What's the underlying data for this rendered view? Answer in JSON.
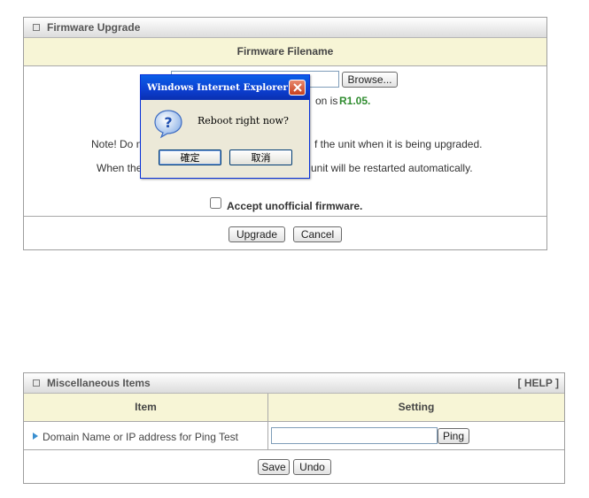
{
  "firmware": {
    "title": "Firmware Upgrade",
    "header": "Firmware Filename",
    "file_value": "",
    "browse_label": "Browse...",
    "version_frag": "on is",
    "version_value": "R1.05.",
    "note_left": "Note! Do n",
    "note_right": "f the unit when it is being upgraded.",
    "when_left": "When the",
    "when_right": "unit will be restarted automatically.",
    "accept_label": "Accept unofficial firmware.",
    "upgrade_label": "Upgrade",
    "cancel_label": "Cancel"
  },
  "dialog": {
    "title": "Windows Internet Explorer",
    "message": "Reboot right now?",
    "ok_label": "確定",
    "cancel_label": "取消",
    "icon": "question-icon"
  },
  "misc": {
    "title": "Miscellaneous Items",
    "help": "[ HELP ]",
    "col_item": "Item",
    "col_setting": "Setting",
    "row_label": "Domain Name or IP address for Ping Test",
    "ping_value": "",
    "ping_label": "Ping",
    "save_label": "Save",
    "undo_label": "Undo"
  },
  "colors": {
    "header_bg": "#f7f5d6",
    "version_green": "#2f8c2f",
    "arrow_blue": "#3a8fd0",
    "dialog_blue": "#0c3fd0"
  }
}
